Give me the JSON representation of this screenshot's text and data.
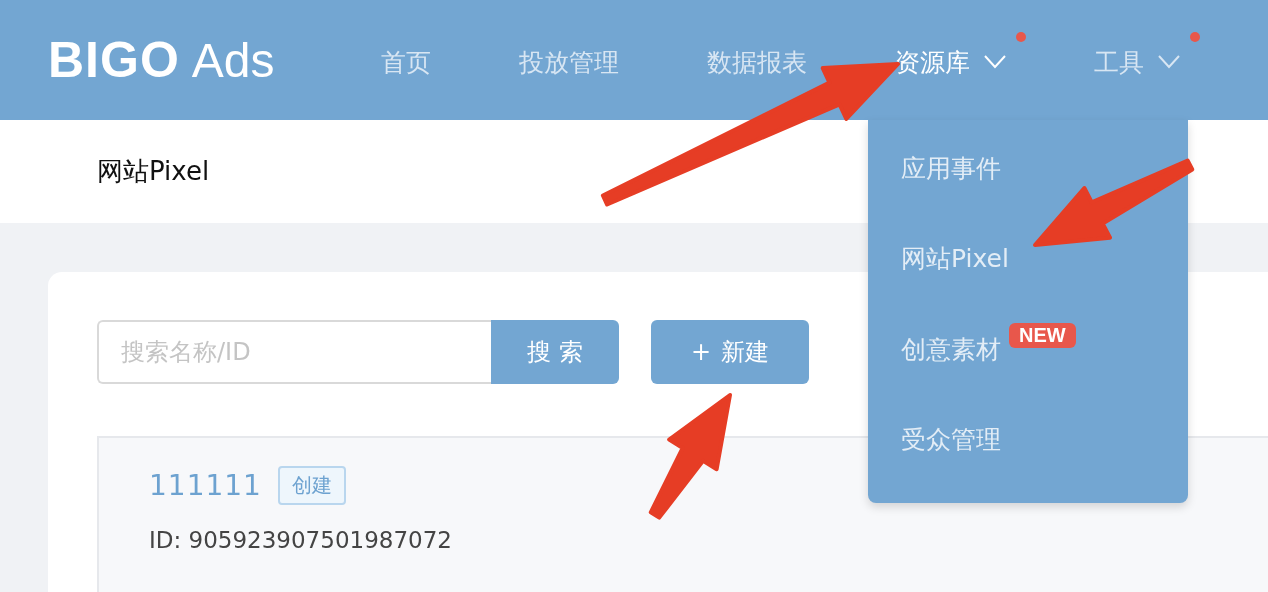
{
  "header": {
    "logo": {
      "brand": "BIGO",
      "suffix": "Ads"
    },
    "nav": [
      {
        "label": "首页",
        "selected": false,
        "has_menu": false,
        "dot": false
      },
      {
        "label": "投放管理",
        "selected": false,
        "has_menu": false,
        "dot": false
      },
      {
        "label": "数据报表",
        "selected": false,
        "has_menu": false,
        "dot": false
      },
      {
        "label": "资源库",
        "selected": true,
        "has_menu": true,
        "dot": true
      },
      {
        "label": "工具",
        "selected": false,
        "has_menu": true,
        "dot": true
      }
    ]
  },
  "dropdown": {
    "items": [
      {
        "label": "应用事件"
      },
      {
        "label": "网站Pixel"
      },
      {
        "label": "创意素材",
        "badge": "NEW"
      },
      {
        "label": "受众管理"
      }
    ]
  },
  "page_title": "网站Pixel",
  "toolbar": {
    "search": {
      "placeholder": "搜索名称/ID",
      "button": "搜 索"
    },
    "create_button": {
      "icon": "+",
      "label": "新建"
    }
  },
  "pixels": [
    {
      "name": "111111",
      "tag": "创建",
      "id_text": "ID: 905923907501987072"
    }
  ]
}
